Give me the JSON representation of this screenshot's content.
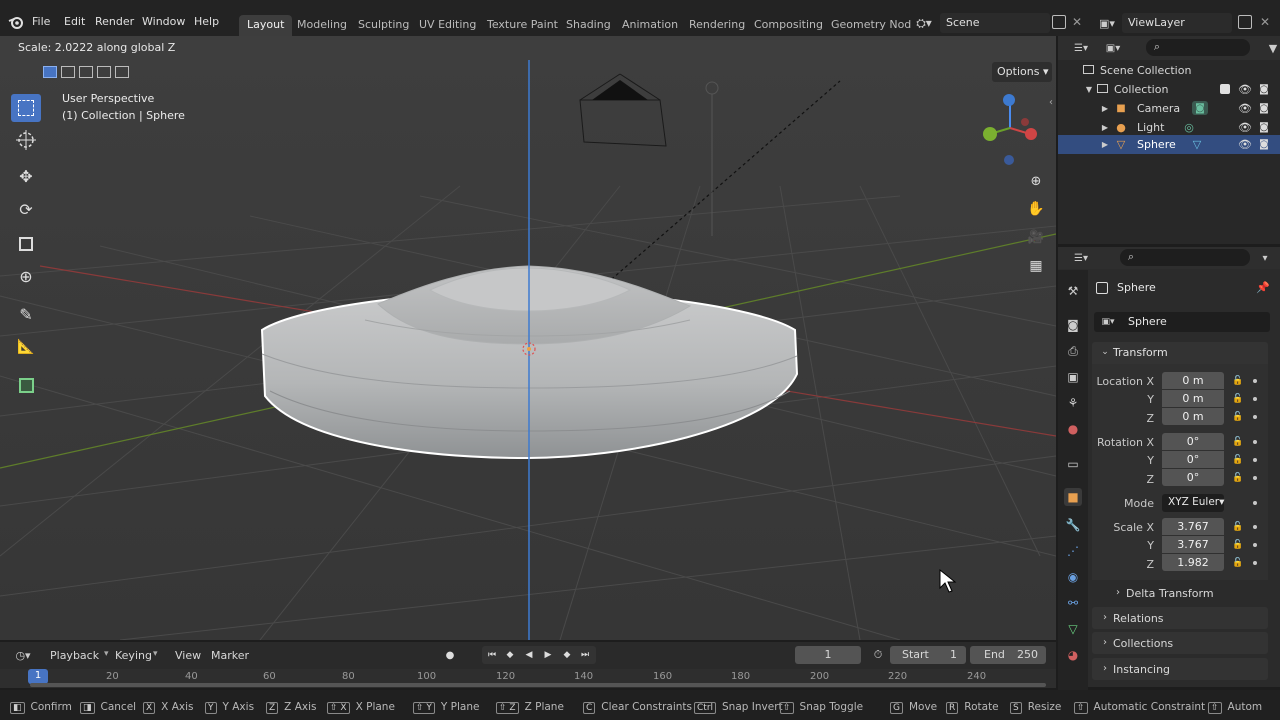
{
  "menu": {
    "file": "File",
    "edit": "Edit",
    "render": "Render",
    "window": "Window",
    "help": "Help"
  },
  "workspaces": [
    "Layout",
    "Modeling",
    "Sculpting",
    "UV Editing",
    "Texture Paint",
    "Shading",
    "Animation",
    "Rendering",
    "Compositing",
    "Geometry Nod"
  ],
  "scene": {
    "name": "Scene",
    "view_layer": "ViewLayer"
  },
  "viewport": {
    "operator_status": "Scale: 2.0222 along global Z",
    "perspective": "User Perspective",
    "collection_info": "(1) Collection | Sphere",
    "options_label": "Options"
  },
  "outliner": {
    "root": "Scene Collection",
    "collection": "Collection",
    "items": [
      "Camera",
      "Light",
      "Sphere"
    ]
  },
  "properties": {
    "object_name": "Sphere",
    "data_name": "Sphere",
    "transform_label": "Transform",
    "location_label": "Location X",
    "rotation_label": "Rotation X",
    "scale_label": "Scale X",
    "y_label": "Y",
    "z_label": "Z",
    "location": [
      "0 m",
      "0 m",
      "0 m"
    ],
    "rotation": [
      "0°",
      "0°",
      "0°"
    ],
    "mode_label": "Mode",
    "mode_value": "XYZ Euler",
    "scale": [
      "3.767",
      "3.767",
      "1.982"
    ],
    "sections": [
      "Delta Transform",
      "Relations",
      "Collections",
      "Instancing"
    ]
  },
  "timeline": {
    "playback": "Playback",
    "keying": "Keying",
    "view": "View",
    "marker": "Marker",
    "current_frame": "1",
    "start_label": "Start",
    "start": "1",
    "end_label": "End",
    "end": "250",
    "ruler": [
      "1",
      "20",
      "40",
      "60",
      "80",
      "100",
      "120",
      "140",
      "160",
      "180",
      "200",
      "220",
      "240"
    ]
  },
  "statusbar": [
    {
      "key": "",
      "label": "Confirm"
    },
    {
      "key": "",
      "label": "Cancel"
    },
    {
      "key": "X",
      "label": "X Axis"
    },
    {
      "key": "Y",
      "label": "Y Axis"
    },
    {
      "key": "Z",
      "label": "Z Axis"
    },
    {
      "key": "⇧ X",
      "label": "X Plane"
    },
    {
      "key": "⇧ Y",
      "label": "Y Plane"
    },
    {
      "key": "⇧ Z",
      "label": "Z Plane"
    },
    {
      "key": "C",
      "label": "Clear Constraints"
    },
    {
      "key": "Ctrl",
      "label": "Snap Invert"
    },
    {
      "key": "⇧",
      "label": "Snap Toggle"
    },
    {
      "key": "G",
      "label": "Move"
    },
    {
      "key": "R",
      "label": "Rotate"
    },
    {
      "key": "S",
      "label": "Resize"
    },
    {
      "key": "⇧",
      "label": "Automatic Constraint"
    },
    {
      "key": "⇧",
      "label": "Autom"
    }
  ],
  "colors": {
    "accent": "#4774c3",
    "selection": "#334d80",
    "axis_z": "#4a8cf0",
    "axis_x": "#c84a4a",
    "axis_y": "#6a9a2a"
  }
}
